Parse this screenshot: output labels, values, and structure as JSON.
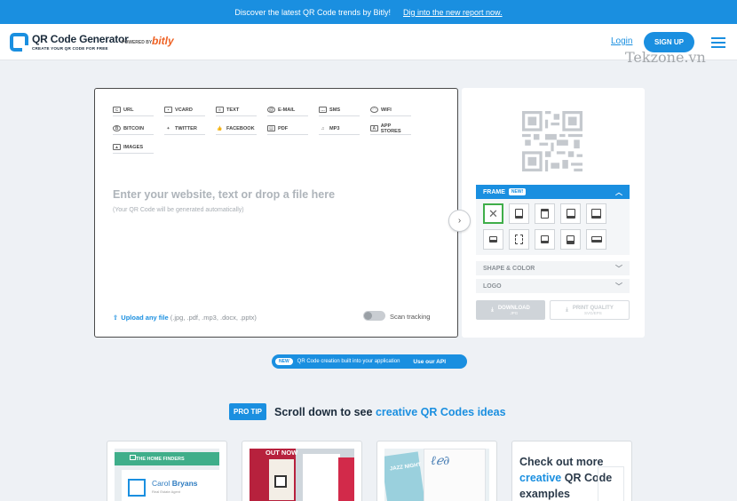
{
  "promo": {
    "text": "Discover the latest QR Code trends by Bitly!",
    "link": "Dig into the new report now."
  },
  "header": {
    "brand_title": "QR Code Generator",
    "brand_sub": "CREATE YOUR QR CODE FOR FREE",
    "powered_by": "POWERED BY",
    "partner": "bitly",
    "login": "Login",
    "signup": "SIGN UP"
  },
  "watermark": "Tekzone.vn",
  "types": [
    {
      "label": "URL",
      "icon": "link-icon"
    },
    {
      "label": "VCARD",
      "icon": "vcard-icon"
    },
    {
      "label": "TEXT",
      "icon": "text-icon"
    },
    {
      "label": "E-MAIL",
      "icon": "at-icon"
    },
    {
      "label": "SMS",
      "icon": "sms-icon"
    },
    {
      "label": "WIFI",
      "icon": "wifi-icon"
    },
    {
      "label": "BITCOIN",
      "icon": "bitcoin-icon"
    },
    {
      "label": "TWITTER",
      "icon": "twitter-icon"
    },
    {
      "label": "FACEBOOK",
      "icon": "facebook-icon"
    },
    {
      "label": "PDF",
      "icon": "pdf-icon"
    },
    {
      "label": "MP3",
      "icon": "music-icon"
    },
    {
      "label": "APP STORES",
      "icon": "app-store-icon"
    },
    {
      "label": "IMAGES",
      "icon": "image-icon"
    }
  ],
  "editor": {
    "placeholder": "Enter your website, text or drop a file here",
    "hint": "(Your QR Code will be generated automatically)",
    "upload_link": "Upload any file",
    "upload_formats": "(.jpg, .pdf, .mp3, .docx, .pptx)",
    "scan_tracking": "Scan tracking"
  },
  "preview": {
    "frame_label": "FRAME",
    "new_badge": "NEW!",
    "shape_color": "SHAPE & COLOR",
    "logo": "LOGO",
    "download": "DOWNLOAD",
    "download_sub": "JPG",
    "print": "PRINT QUALITY",
    "print_sub": "SVG/EPS"
  },
  "api": {
    "badge": "NEW",
    "text": "QR Code creation built into your application",
    "link": "Use our API"
  },
  "tip": {
    "badge": "PRO TIP",
    "text": "Scroll down to see ",
    "highlight": "creative QR Codes ideas"
  },
  "cards": {
    "card1_banner": "THE HOME FINDERS",
    "card1_first": "Carol",
    "card1_last": "Bryans",
    "card1_role": "Real Estate Agent",
    "card2_label": "OUT NOW",
    "card3_label": "JAZZ NIGHT",
    "card4_line1": "Check out more",
    "card4_hl": "creative",
    "card4_line2": " QR Code",
    "card4_line3": "examples"
  },
  "colors": {
    "accent": "#1a8fe0",
    "selected": "#3fae49",
    "partner": "#ee6123"
  }
}
